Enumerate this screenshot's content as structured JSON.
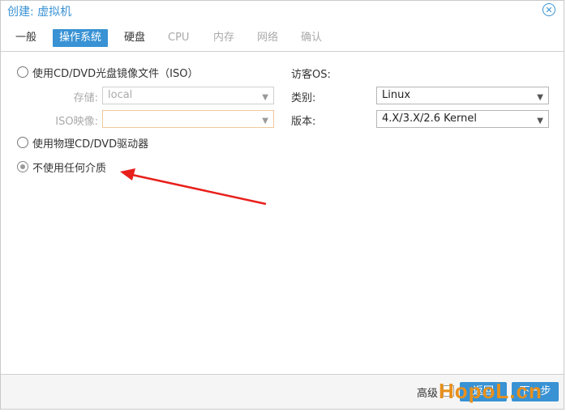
{
  "dialog": {
    "title": "创建: 虚拟机",
    "close_icon": "close-circle-icon"
  },
  "tabs": [
    {
      "label": "一般",
      "state": "normal"
    },
    {
      "label": "操作系统",
      "state": "active"
    },
    {
      "label": "硬盘",
      "state": "normal"
    },
    {
      "label": "CPU",
      "state": "disabled"
    },
    {
      "label": "内存",
      "state": "disabled"
    },
    {
      "label": "网络",
      "state": "disabled"
    },
    {
      "label": "确认",
      "state": "disabled"
    }
  ],
  "media": {
    "iso_option": "使用CD/DVD光盘镜像文件（ISO）",
    "storage_label": "存储:",
    "storage_value": "local",
    "iso_image_label": "ISO映像:",
    "iso_image_value": "",
    "physical_option": "使用物理CD/DVD驱动器",
    "none_option": "不使用任何介质",
    "selected": "none"
  },
  "guest_os": {
    "heading": "访客OS:",
    "type_label": "类别:",
    "type_value": "Linux",
    "version_label": "版本:",
    "version_value": "4.X/3.X/2.6 Kernel"
  },
  "annotation": {
    "arrow_color": "#e8201c"
  },
  "footer": {
    "advanced_label": "高级",
    "back_label": "返回",
    "next_label": "下一步"
  },
  "watermark": {
    "text": "HopoL.cn"
  },
  "colors": {
    "accent": "#3892d4",
    "watermark": "#e8901c"
  }
}
